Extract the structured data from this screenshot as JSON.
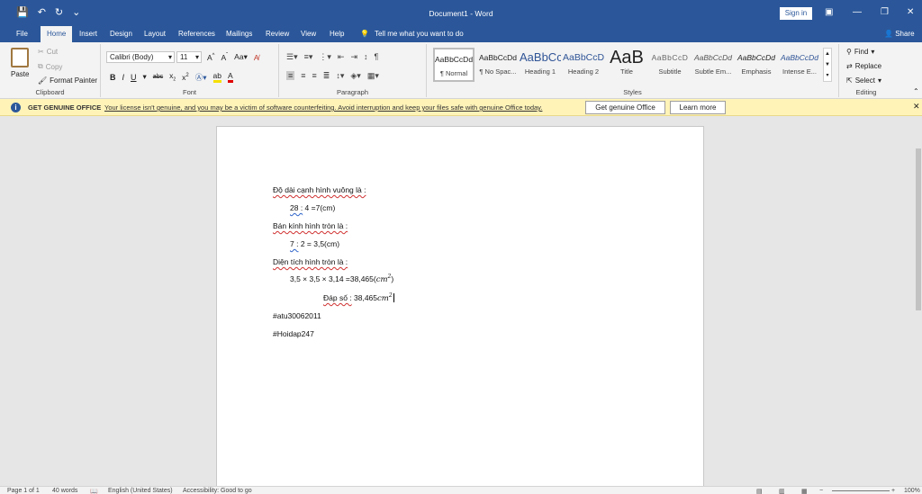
{
  "titlebar": {
    "title": "Document1 - Word",
    "signin": "Sign in",
    "qat": {
      "save": "💾",
      "undo": "↶",
      "redo": "↻",
      "customize": "⌄"
    }
  },
  "tabs": [
    {
      "label": "File"
    },
    {
      "label": "Home"
    },
    {
      "label": "Insert"
    },
    {
      "label": "Design"
    },
    {
      "label": "Layout"
    },
    {
      "label": "References"
    },
    {
      "label": "Mailings"
    },
    {
      "label": "Review"
    },
    {
      "label": "View"
    },
    {
      "label": "Help"
    }
  ],
  "tellme": "Tell me what you want to do",
  "share": "Share",
  "clipboard": {
    "paste": "Paste",
    "cut": "Cut",
    "copy": "Copy",
    "format_painter": "Format Painter",
    "label": "Clipboard"
  },
  "font": {
    "name": "Calibri (Body)",
    "size": "11",
    "label": "Font"
  },
  "paragraph": {
    "label": "Paragraph"
  },
  "styles": {
    "items": [
      {
        "sample": "AaBbCcDd",
        "name": "¶ Normal"
      },
      {
        "sample": "AaBbCcDd",
        "name": "¶ No Spac..."
      },
      {
        "sample": "AaBbCc",
        "name": "Heading 1"
      },
      {
        "sample": "AaBbCcD",
        "name": "Heading 2"
      },
      {
        "sample": "AaB",
        "name": "Title"
      },
      {
        "sample": "AaBbCcD",
        "name": "Subtitle"
      },
      {
        "sample": "AaBbCcDd",
        "name": "Subtle Em..."
      },
      {
        "sample": "AaBbCcDd",
        "name": "Emphasis"
      },
      {
        "sample": "AaBbCcDd",
        "name": "Intense E..."
      }
    ],
    "label": "Styles"
  },
  "editing": {
    "find": "Find",
    "replace": "Replace",
    "select": "Select",
    "label": "Editing"
  },
  "message_bar": {
    "title": "GET GENUINE OFFICE",
    "text": "Your license isn't genuine, and you may be a victim of software counterfeiting. Avoid interruption and keep your files safe with genuine Office today.",
    "btn_genuine": "Get genuine Office",
    "btn_learn": "Learn more"
  },
  "document": {
    "l1": "Độ dài cạnh hình vuông là :",
    "l2a": "28 :",
    "l2b": " 4 =7(cm)",
    "l3": "Bán kính hình tròn là :",
    "l4a": "7 :",
    "l4b": " 2 = 3,5(cm)",
    "l5": "Diện tích hình tròn là :",
    "l6a": "3,5 × 3,5 × 3,14 =38,465(",
    "l6m": "cm",
    "l6s": "2",
    "l6c": ")",
    "l7a": "Đáp số :",
    "l7b": " 38,465",
    "l7m": "cm",
    "l7s": "2",
    "l8": "#atu30062011",
    "l9": "#Hoidap247"
  },
  "statusbar": {
    "page": "Page 1 of 1",
    "words": "40 words",
    "lang": "English (United States)",
    "access": "Accessibility: Good to go",
    "zoom": "100%"
  }
}
